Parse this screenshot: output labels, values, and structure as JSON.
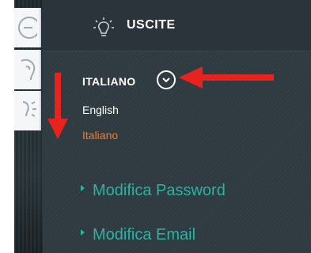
{
  "header": {
    "title": "USCITE",
    "icon": "lightbulb-icon"
  },
  "language": {
    "current_label": "ITALIANO",
    "toggle_icon": "chevron-down-icon",
    "options": [
      "English",
      "Italiano"
    ],
    "selected": "Italiano"
  },
  "menu": {
    "items": [
      {
        "label": "Modifica Password"
      },
      {
        "label": "Modifica Email"
      }
    ]
  },
  "sidebar": {
    "icons": [
      "circle-arrow-icon",
      "user-head-icon",
      "lightbulb-icon"
    ]
  },
  "colors": {
    "panel_bg": "#2f3a41",
    "accent_teal": "#2bb3a3",
    "selected_orange": "#ff7a1a",
    "annotation_red": "#e8231d"
  }
}
